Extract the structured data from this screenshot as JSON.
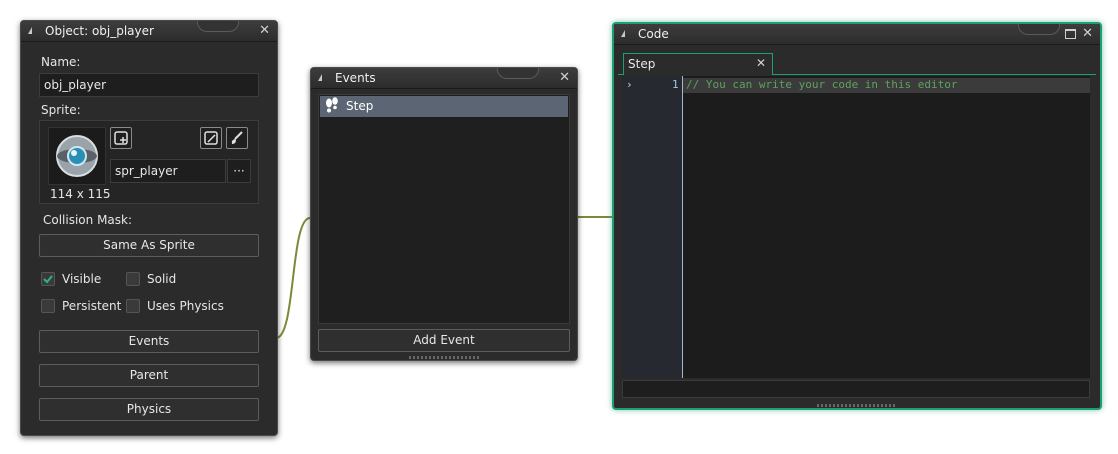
{
  "object_panel": {
    "title": "Object: obj_player",
    "name_label": "Name:",
    "name_value": "obj_player",
    "sprite_label": "Sprite:",
    "sprite_value": "spr_player",
    "sprite_size": "114 x 115",
    "sprite_menu": "···",
    "collision_label": "Collision Mask:",
    "collision_button": "Same As Sprite",
    "checks": {
      "visible": {
        "label": "Visible",
        "checked": true
      },
      "solid": {
        "label": "Solid",
        "checked": false
      },
      "persistent": {
        "label": "Persistent",
        "checked": false
      },
      "uses_physics": {
        "label": "Uses Physics",
        "checked": false
      }
    },
    "events_button": "Events",
    "parent_button": "Parent",
    "physics_button": "Physics"
  },
  "events_panel": {
    "title": "Events",
    "items": [
      {
        "label": "Step",
        "icon": "footprints-icon",
        "selected": true
      }
    ],
    "add_button": "Add Event"
  },
  "code_panel": {
    "title": "Code",
    "tab_label": "Step",
    "line_number": "1",
    "code_line": "// You can write your code in this editor"
  },
  "colors": {
    "accent_green": "#1e9e74",
    "comment_green": "#5fa05f",
    "selection": "#5b6573",
    "connector": "#7a8a3a"
  }
}
